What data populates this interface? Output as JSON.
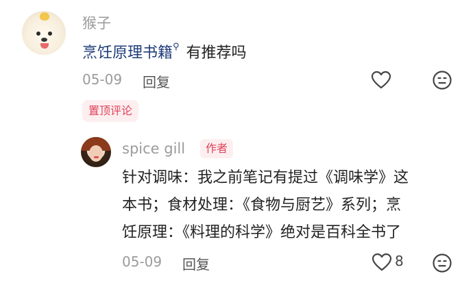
{
  "comment": {
    "username": "猴子",
    "text_link": "烹饪原理书籍",
    "text_rest": "有推荐吗",
    "date": "05-09",
    "reply_label": "回复",
    "pinned_label": "置顶评论",
    "icons": {
      "search": "search-icon",
      "like": "heart-icon",
      "emoji": "emoji-face-icon"
    }
  },
  "reply": {
    "username": "spice gill",
    "author_badge": "作者",
    "lines": [
      "针对调味：我之前笔记有提过《调味学》这",
      "本书；食材处理：《食物与厨艺》系列；烹",
      "饪原理：《料理的科学》绝对是百科全书了"
    ],
    "date": "05-09",
    "reply_label": "回复",
    "like_count": "8"
  },
  "colors": {
    "link": "#1f3d7a",
    "accent": "#e0425a",
    "badge_bg": "#fdeff0",
    "muted": "#9b9b9b"
  }
}
